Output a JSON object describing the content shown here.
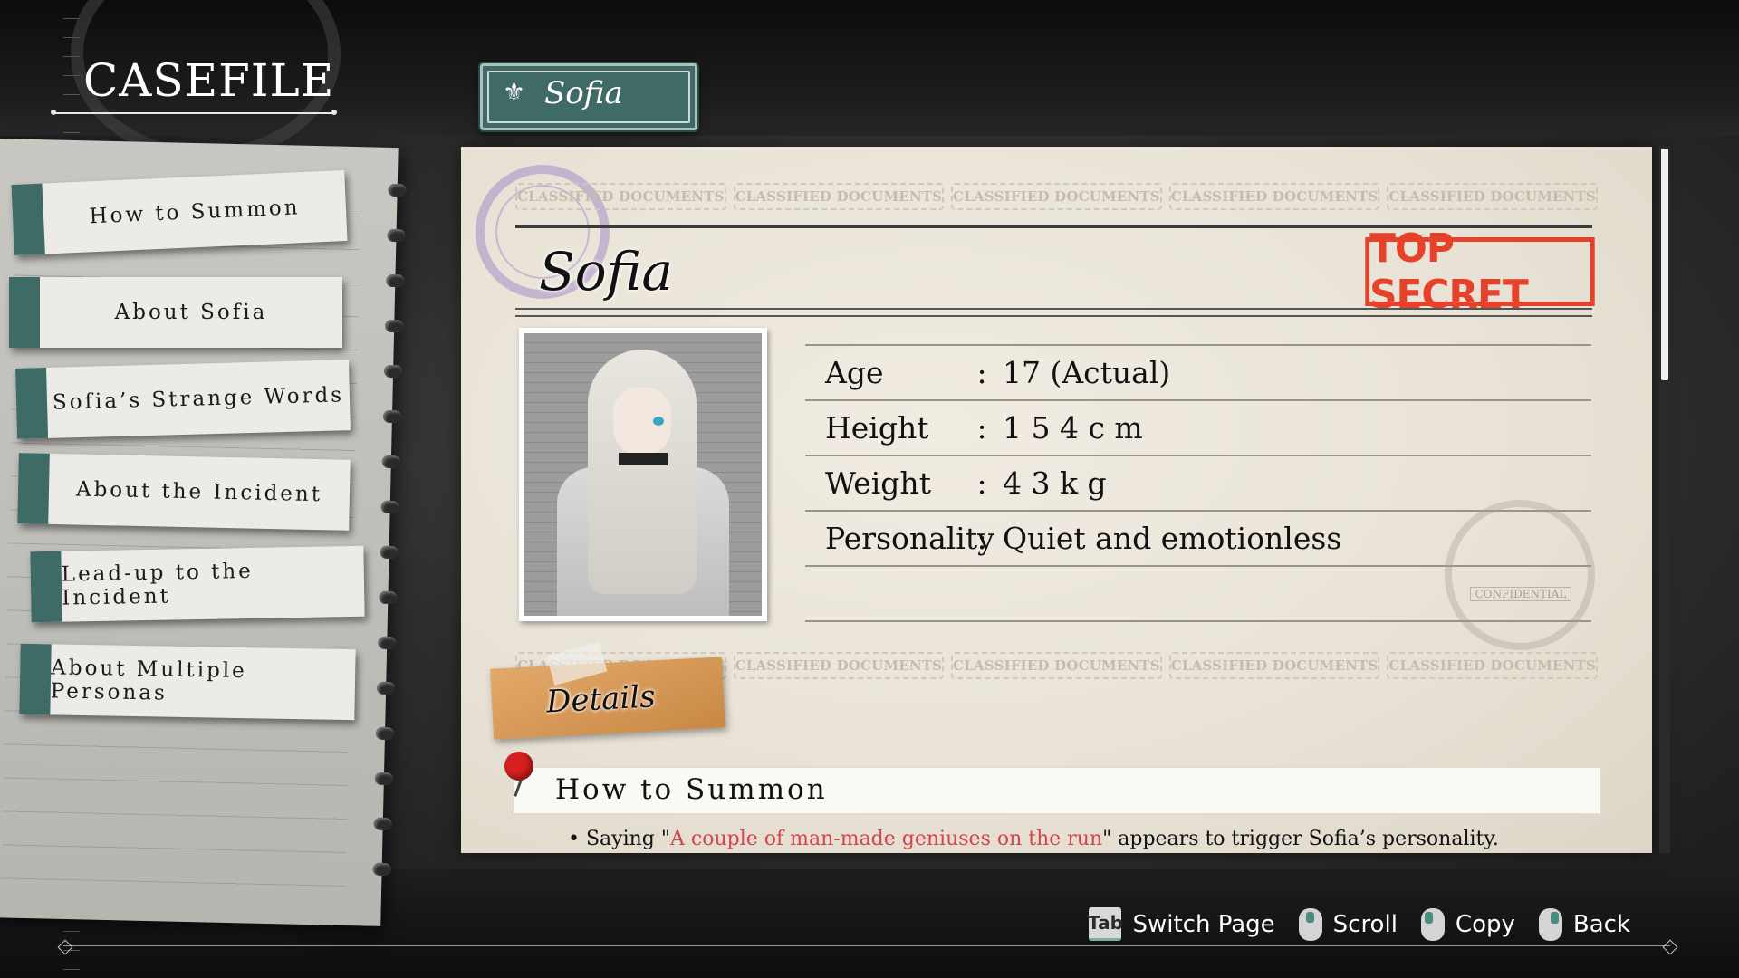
{
  "header": {
    "title": "CASEFILE",
    "character_tab": "Sofia"
  },
  "menu": {
    "items": [
      {
        "label": "How to Summon"
      },
      {
        "label": "About Sofia"
      },
      {
        "label": "Sofia’s Strange Words"
      },
      {
        "label": "About the Incident"
      },
      {
        "label": "Lead-up to the Incident"
      },
      {
        "label": "About Multiple Personas"
      }
    ]
  },
  "document": {
    "strip_label": "CLASSIFIED DOCUMENTS",
    "name": "Sofia",
    "stamp": "TOP SECRET",
    "seal_label": "CONFIDENTIAL",
    "profile": [
      {
        "label": "Age",
        "colon": ":",
        "value": "17 (Actual)"
      },
      {
        "label": "Height",
        "colon": ":",
        "value": "1 5 4 c m"
      },
      {
        "label": "Weight",
        "colon": ":",
        "value": "4 3 k g"
      },
      {
        "label": "Personality",
        "colon": ":",
        "value": "Quiet and emotionless"
      }
    ],
    "details_tag": "Details",
    "section": {
      "title": "How to Summon",
      "text_before": "• Saying \"",
      "text_highlight": "A couple of man-made geniuses on the run",
      "text_after": "\" appears to trigger Sofia’s personality."
    }
  },
  "controls": {
    "switch": {
      "key": "Tab",
      "label": "Switch Page"
    },
    "scroll": {
      "label": "Scroll"
    },
    "copy": {
      "label": "Copy"
    },
    "back": {
      "label": "Back"
    }
  },
  "colors": {
    "accent_teal": "#3f6b66",
    "stamp_red": "#e5412b",
    "highlight": "#d6434b"
  }
}
